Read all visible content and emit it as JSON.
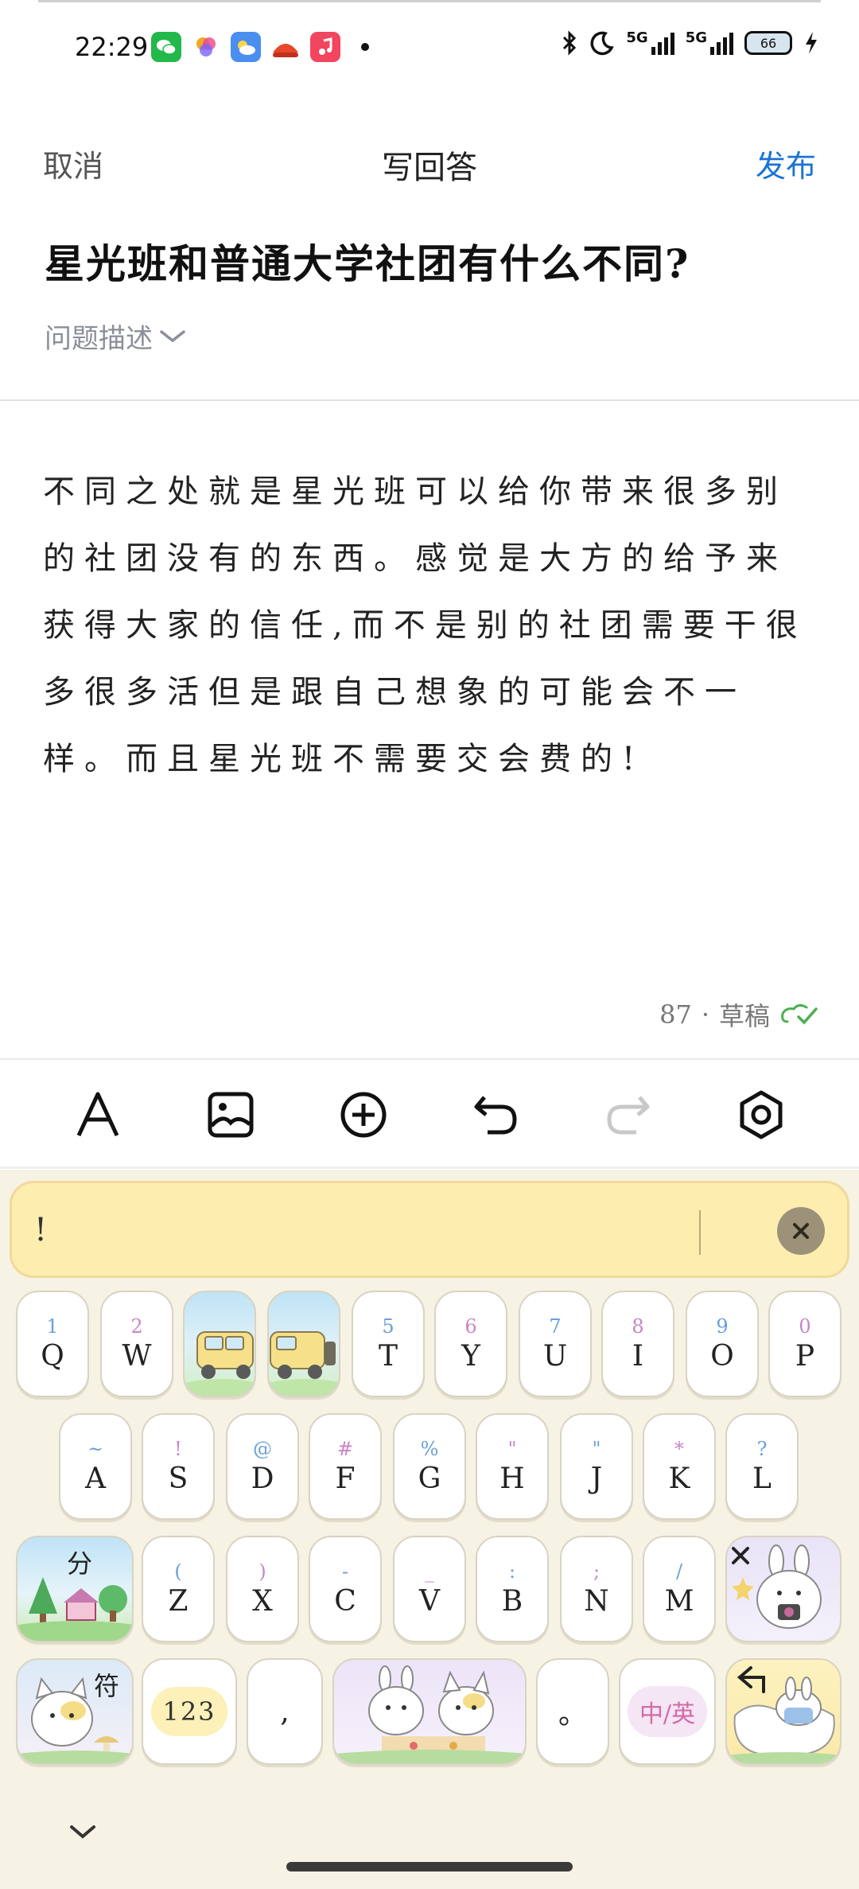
{
  "status_bar": {
    "time": "22:29",
    "battery": "66",
    "net1": "5G",
    "net2": "5G"
  },
  "header": {
    "cancel": "取消",
    "title": "写回答",
    "publish": "发布"
  },
  "question": {
    "title": "星光班和普通大学社团有什么不同?",
    "desc_toggle": "问题描述"
  },
  "answer": {
    "text": "不同之处就是星光班可以给你带来很多别的社团没有的东西。感觉是大方的给予来获得大家的信任,而不是别的社团需要干很多很多活但是跟自己想象的可能会不一样。而且星光班不需要交会费的!"
  },
  "draft": {
    "count": "87",
    "sep": "·",
    "label": "草稿"
  },
  "toolbar": [
    "format-text",
    "insert-image",
    "insert-plus",
    "undo",
    "redo",
    "settings"
  ],
  "keyboard": {
    "candidate": "!",
    "row1": [
      {
        "id": "q",
        "sub": "1",
        "main": "Q",
        "sub_color": "#6aa0d8"
      },
      {
        "id": "w",
        "sub": "2",
        "main": "W",
        "sub_color": "#c985c8"
      },
      {
        "id": "t",
        "sub": "5",
        "main": "T",
        "sub_color": "#6aa0d8"
      },
      {
        "id": "y",
        "sub": "6",
        "main": "Y",
        "sub_color": "#c985c8"
      },
      {
        "id": "u",
        "sub": "7",
        "main": "U",
        "sub_color": "#6aa0d8"
      },
      {
        "id": "i",
        "sub": "8",
        "main": "I",
        "sub_color": "#c985c8"
      },
      {
        "id": "o",
        "sub": "9",
        "main": "O",
        "sub_color": "#6aa0d8"
      },
      {
        "id": "p",
        "sub": "0",
        "main": "P",
        "sub_color": "#c985c8"
      }
    ],
    "row2": [
      {
        "id": "a",
        "sub": "~",
        "main": "A",
        "sub_color": "#6aa0d8"
      },
      {
        "id": "s",
        "sub": "!",
        "main": "S",
        "sub_color": "#c985c8"
      },
      {
        "id": "d",
        "sub": "@",
        "main": "D",
        "sub_color": "#6aa0d8"
      },
      {
        "id": "f",
        "sub": "#",
        "main": "F",
        "sub_color": "#c985c8"
      },
      {
        "id": "g",
        "sub": "%",
        "main": "G",
        "sub_color": "#6aa0d8"
      },
      {
        "id": "h",
        "sub": "\"",
        "main": "H",
        "sub_color": "#c985c8"
      },
      {
        "id": "j",
        "sub": "\"",
        "main": "J",
        "sub_color": "#6aa0d8"
      },
      {
        "id": "k",
        "sub": "*",
        "main": "K",
        "sub_color": "#c985c8"
      },
      {
        "id": "l",
        "sub": "?",
        "main": "L",
        "sub_color": "#6aa0d8"
      }
    ],
    "row3": [
      {
        "id": "z",
        "sub": "(",
        "main": "Z",
        "sub_color": "#6aa0d8"
      },
      {
        "id": "x",
        "sub": ")",
        "main": "X",
        "sub_color": "#c985c8"
      },
      {
        "id": "c",
        "sub": "-",
        "main": "C",
        "sub_color": "#6aa0d8"
      },
      {
        "id": "v",
        "sub": "_",
        "main": "V",
        "sub_color": "#c985c8"
      },
      {
        "id": "b",
        "sub": ":",
        "main": "B",
        "sub_color": "#6aa0d8"
      },
      {
        "id": "n",
        "sub": ";",
        "main": "N",
        "sub_color": "#c985c8"
      },
      {
        "id": "m",
        "sub": "/",
        "main": "M",
        "sub_color": "#6aa0d8"
      }
    ],
    "fen": "分",
    "fu": "符",
    "num": "123",
    "comma": ",",
    "period": "。",
    "lang": "中/英"
  }
}
